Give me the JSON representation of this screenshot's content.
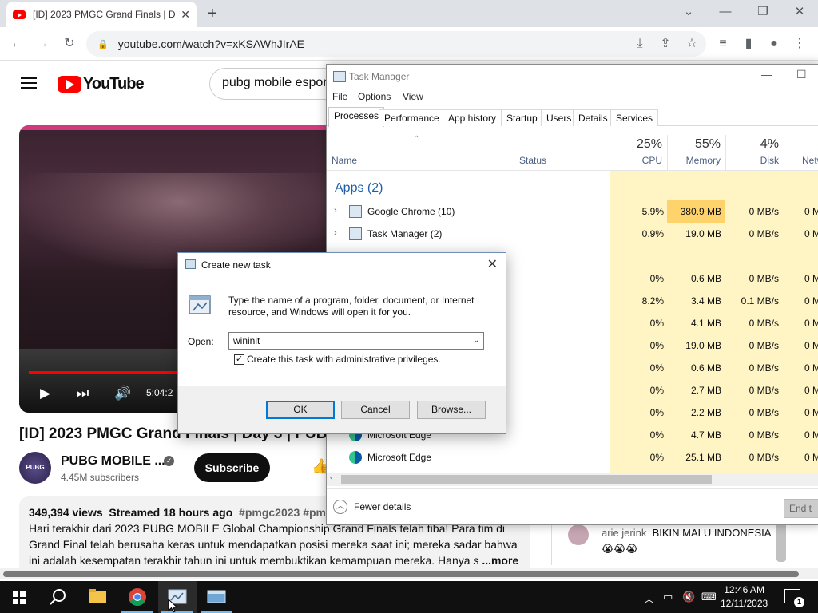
{
  "chrome": {
    "tab_title": "[ID] 2023 PMGC Grand Finals | D",
    "tab_close": "✕",
    "new_tab": "+",
    "url": "youtube.com/watch?v=xKSAWhJIrAE"
  },
  "youtube": {
    "search_value": "pubg mobile espor",
    "video_time": "5:04:2",
    "video_title": "[ID] 2023 PMGC Grand Finals | Day 3 | PUBG",
    "channel_name": "PUBG MOBILE ...",
    "channel_avatar_text": "PUBG",
    "subscribers": "4.45M subscribers",
    "subscribe_label": "Subscribe",
    "description": {
      "views": "349,394 views",
      "streamed": "Streamed 18 hours ago",
      "tags": "#pmgc2023 #pmgc",
      "text": "Hari terakhir dari 2023 PUBG MOBILE Global Championship Grand Finals telah tiba! Para tim di Grand Final telah berusaha keras untuk mendapatkan posisi mereka saat ini; mereka sadar bahwa ini adalah kesempatan terakhir tahun ini untuk membuktikan kemampuan mereka. Hanya s",
      "more": "...more"
    },
    "comment": {
      "author": "arie jerink",
      "text": "BIKIN MALU INDONESIA 😭😭😭"
    }
  },
  "task_manager": {
    "title": "Task Manager",
    "menu": [
      "File",
      "Options",
      "View"
    ],
    "tabs": [
      "Processes",
      "Performance",
      "App history",
      "Startup",
      "Users",
      "Details",
      "Services"
    ],
    "headers": {
      "name": "Name",
      "status": "Status",
      "cpu_pct": "25%",
      "cpu": "CPU",
      "mem_pct": "55%",
      "mem": "Memory",
      "disk_pct": "4%",
      "disk": "Disk",
      "net": "Netw"
    },
    "apps_group": "Apps (2)",
    "rows": [
      {
        "name": "Google Chrome (10)",
        "cpu": "5.9%",
        "mem": "380.9 MB",
        "disk": "0 MB/s",
        "net": "0 M"
      },
      {
        "name": "Task Manager (2)",
        "cpu": "0.9%",
        "mem": "19.0 MB",
        "disk": "0 MB/s",
        "net": "0 M"
      },
      {
        "name": "",
        "cpu": "",
        "mem": "",
        "disk": "",
        "net": ""
      },
      {
        "name": "",
        "cpu": "0%",
        "mem": "0.6 MB",
        "disk": "0 MB/s",
        "net": "0 M"
      },
      {
        "name": "",
        "cpu": "8.2%",
        "mem": "3.4 MB",
        "disk": "0.1 MB/s",
        "net": "0 M"
      },
      {
        "name": "",
        "cpu": "0%",
        "mem": "4.1 MB",
        "disk": "0 MB/s",
        "net": "0 M"
      },
      {
        "name": "",
        "cpu": "0%",
        "mem": "19.0 MB",
        "disk": "0 MB/s",
        "net": "0 M"
      },
      {
        "name": "",
        "cpu": "0%",
        "mem": "0.6 MB",
        "disk": "0 MB/s",
        "net": "0 M"
      },
      {
        "name": "",
        "cpu": "0%",
        "mem": "2.7 MB",
        "disk": "0 MB/s",
        "net": "0 M"
      },
      {
        "name": "",
        "cpu": "0%",
        "mem": "2.2 MB",
        "disk": "0 MB/s",
        "net": "0 M"
      },
      {
        "name": "Microsoft Edge",
        "cpu": "0%",
        "mem": "4.7 MB",
        "disk": "0 MB/s",
        "net": "0 M"
      },
      {
        "name": "Microsoft Edge",
        "cpu": "0%",
        "mem": "25.1 MB",
        "disk": "0 MB/s",
        "net": "0 M"
      }
    ],
    "fewer_details": "Fewer details",
    "end_task": "End t"
  },
  "run_dialog": {
    "title": "Create new task",
    "message": "Type the name of a program, folder, document, or Internet resource, and Windows will open it for you.",
    "open_label": "Open:",
    "open_value": "wininit",
    "admin_label": "Create this task with administrative privileges.",
    "admin_checked": "✓",
    "ok": "OK",
    "cancel": "Cancel",
    "browse": "Browse..."
  },
  "taskbar": {
    "time": "12:46 AM",
    "date": "12/11/2023",
    "notifications": "1"
  },
  "colors": {
    "youtube_red": "#ff0000",
    "tm_highlight": "#fff4c4",
    "tm_strong": "#ffd36b",
    "accent": "#0078d7"
  }
}
